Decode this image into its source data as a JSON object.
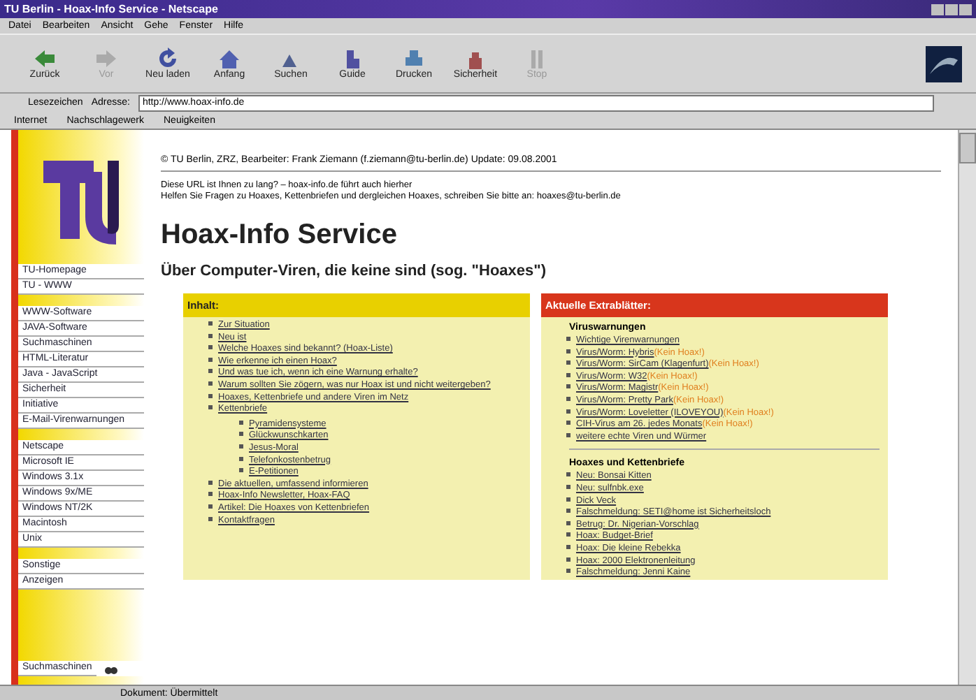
{
  "window": {
    "title": "TU Berlin - Hoax-Info Service - Netscape"
  },
  "menu": [
    "Datei",
    "Bearbeiten",
    "Ansicht",
    "Gehe",
    "Fenster",
    "Hilfe"
  ],
  "toolbar": [
    {
      "label": "Zurück",
      "kind": "back",
      "disabled": false
    },
    {
      "label": "Vor",
      "kind": "forward",
      "disabled": true
    },
    {
      "label": "Neu laden",
      "kind": "reload",
      "disabled": false
    },
    {
      "label": "Anfang",
      "kind": "home",
      "disabled": false
    },
    {
      "label": "Suchen",
      "kind": "search",
      "disabled": false
    },
    {
      "label": "Guide",
      "kind": "guide",
      "disabled": false
    },
    {
      "label": "Drucken",
      "kind": "print",
      "disabled": false
    },
    {
      "label": "Sicherheit",
      "kind": "security",
      "disabled": false
    },
    {
      "label": "Stop",
      "kind": "stop",
      "disabled": true
    }
  ],
  "location": {
    "bookmarks": "Lesezeichen",
    "address_label": "Adresse:",
    "url": "http://www.hoax-info.de"
  },
  "personal_bar": [
    "Internet",
    "Nachschlagewerk",
    "Neuigkeiten"
  ],
  "sidebar": {
    "groups": [
      [
        "TU-Homepage",
        "TU - WWW"
      ],
      [
        "WWW-Software",
        "JAVA-Software",
        "Suchmaschinen",
        "HTML-Literatur",
        "Java - JavaScript",
        "Sicherheit",
        "Initiative",
        "E-Mail-Virenwarnungen"
      ],
      [
        "Netscape",
        "Microsoft IE",
        "Windows 3.1x",
        "Windows 9x/ME",
        "Windows NT/2K",
        "Macintosh",
        "Unix"
      ],
      [
        "Sonstige",
        "Anzeigen"
      ]
    ],
    "search": "Suchmaschinen"
  },
  "page": {
    "credit": "© TU Berlin, ZRZ, Bearbeiter: Frank Ziemann (f.ziemann@tu-berlin.de) Update: 09.08.2001",
    "intro_1": "Diese URL ist Ihnen zu lang? – hoax-info.de führt auch hierher",
    "intro_2": "Helfen Sie Fragen zu Hoaxes, Kettenbriefen und dergleichen Hoaxes, schreiben Sie bitte an: hoaxes@tu-berlin.de",
    "title": "Hoax-Info Service",
    "subtitle": "Über Computer-Viren, die keine sind (sog. \"Hoaxes\")"
  },
  "contents": {
    "heading": "Inhalt:",
    "items": [
      {
        "text": "Zur Situation"
      },
      {
        "text": "Neu ist"
      },
      {
        "text": "Welche Hoaxes sind bekannt? (Hoax-Liste)"
      },
      {
        "text": "Wie erkenne ich einen Hoax?"
      },
      {
        "text": "Und was tue ich, wenn ich eine Warnung erhalte?"
      },
      {
        "text": "Warum sollten Sie zögern, was nur Hoax ist und nicht weitergeben?"
      },
      {
        "text": "Hoaxes, Kettenbriefe und andere Viren im Netz"
      },
      {
        "text": "Kettenbriefe",
        "children": [
          {
            "text": "Pyramidensysteme"
          },
          {
            "text": "Glückwunschkarten"
          },
          {
            "text": "Jesus-Moral"
          },
          {
            "text": "Telefonkostenbetrug"
          },
          {
            "text": "E-Petitionen"
          }
        ]
      },
      {
        "text": "Die aktuellen, umfassend informieren"
      },
      {
        "text": "Hoax-Info Newsletter, Hoax-FAQ"
      },
      {
        "text": "Artikel: Die Hoaxes von Kettenbriefen"
      },
      {
        "text": "Kontaktfragen"
      }
    ]
  },
  "extras": {
    "heading": "Aktuelle Extrablätter:",
    "sections": [
      {
        "title": "Viruswarnungen",
        "items": [
          {
            "text": "Wichtige Virenwarnungen"
          },
          {
            "text": "Virus/Worm: Hybris",
            "note": "(Kein Hoax!)"
          },
          {
            "text": "Virus/Worm: SirCam (Klagenfurt)",
            "note": "(Kein Hoax!)"
          },
          {
            "text": "Virus/Worm: W32",
            "note": "(Kein Hoax!)"
          },
          {
            "text": "Virus/Worm: Magistr",
            "note": "(Kein Hoax!)"
          },
          {
            "text": "Virus/Worm: Pretty Park",
            "note": "(Kein Hoax!)"
          },
          {
            "text": "Virus/Worm: Loveletter (ILOVEYOU)",
            "note": "(Kein Hoax!)"
          },
          {
            "text": "CIH-Virus am 26. jedes Monats",
            "note": "(Kein Hoax!)"
          },
          {
            "text": "weitere echte Viren und Würmer"
          }
        ]
      },
      {
        "title": "Hoaxes und Kettenbriefe",
        "items": [
          {
            "text": "Neu: Bonsai Kitten"
          },
          {
            "text": "Neu: sulfnbk.exe"
          },
          {
            "text": "Dick Veck"
          },
          {
            "text": "Falschmeldung: SETI@home ist Sicherheitsloch"
          },
          {
            "text": "Betrug: Dr. Nigerian-Vorschlag"
          },
          {
            "text": "Hoax: Budget-Brief"
          },
          {
            "text": "Hoax: Die kleine Rebekka"
          },
          {
            "text": "Hoax: 2000 Elektronenleitung"
          },
          {
            "text": "Falschmeldung: Jenni Kaine"
          }
        ]
      }
    ]
  },
  "status": "Dokument: Übermittelt"
}
